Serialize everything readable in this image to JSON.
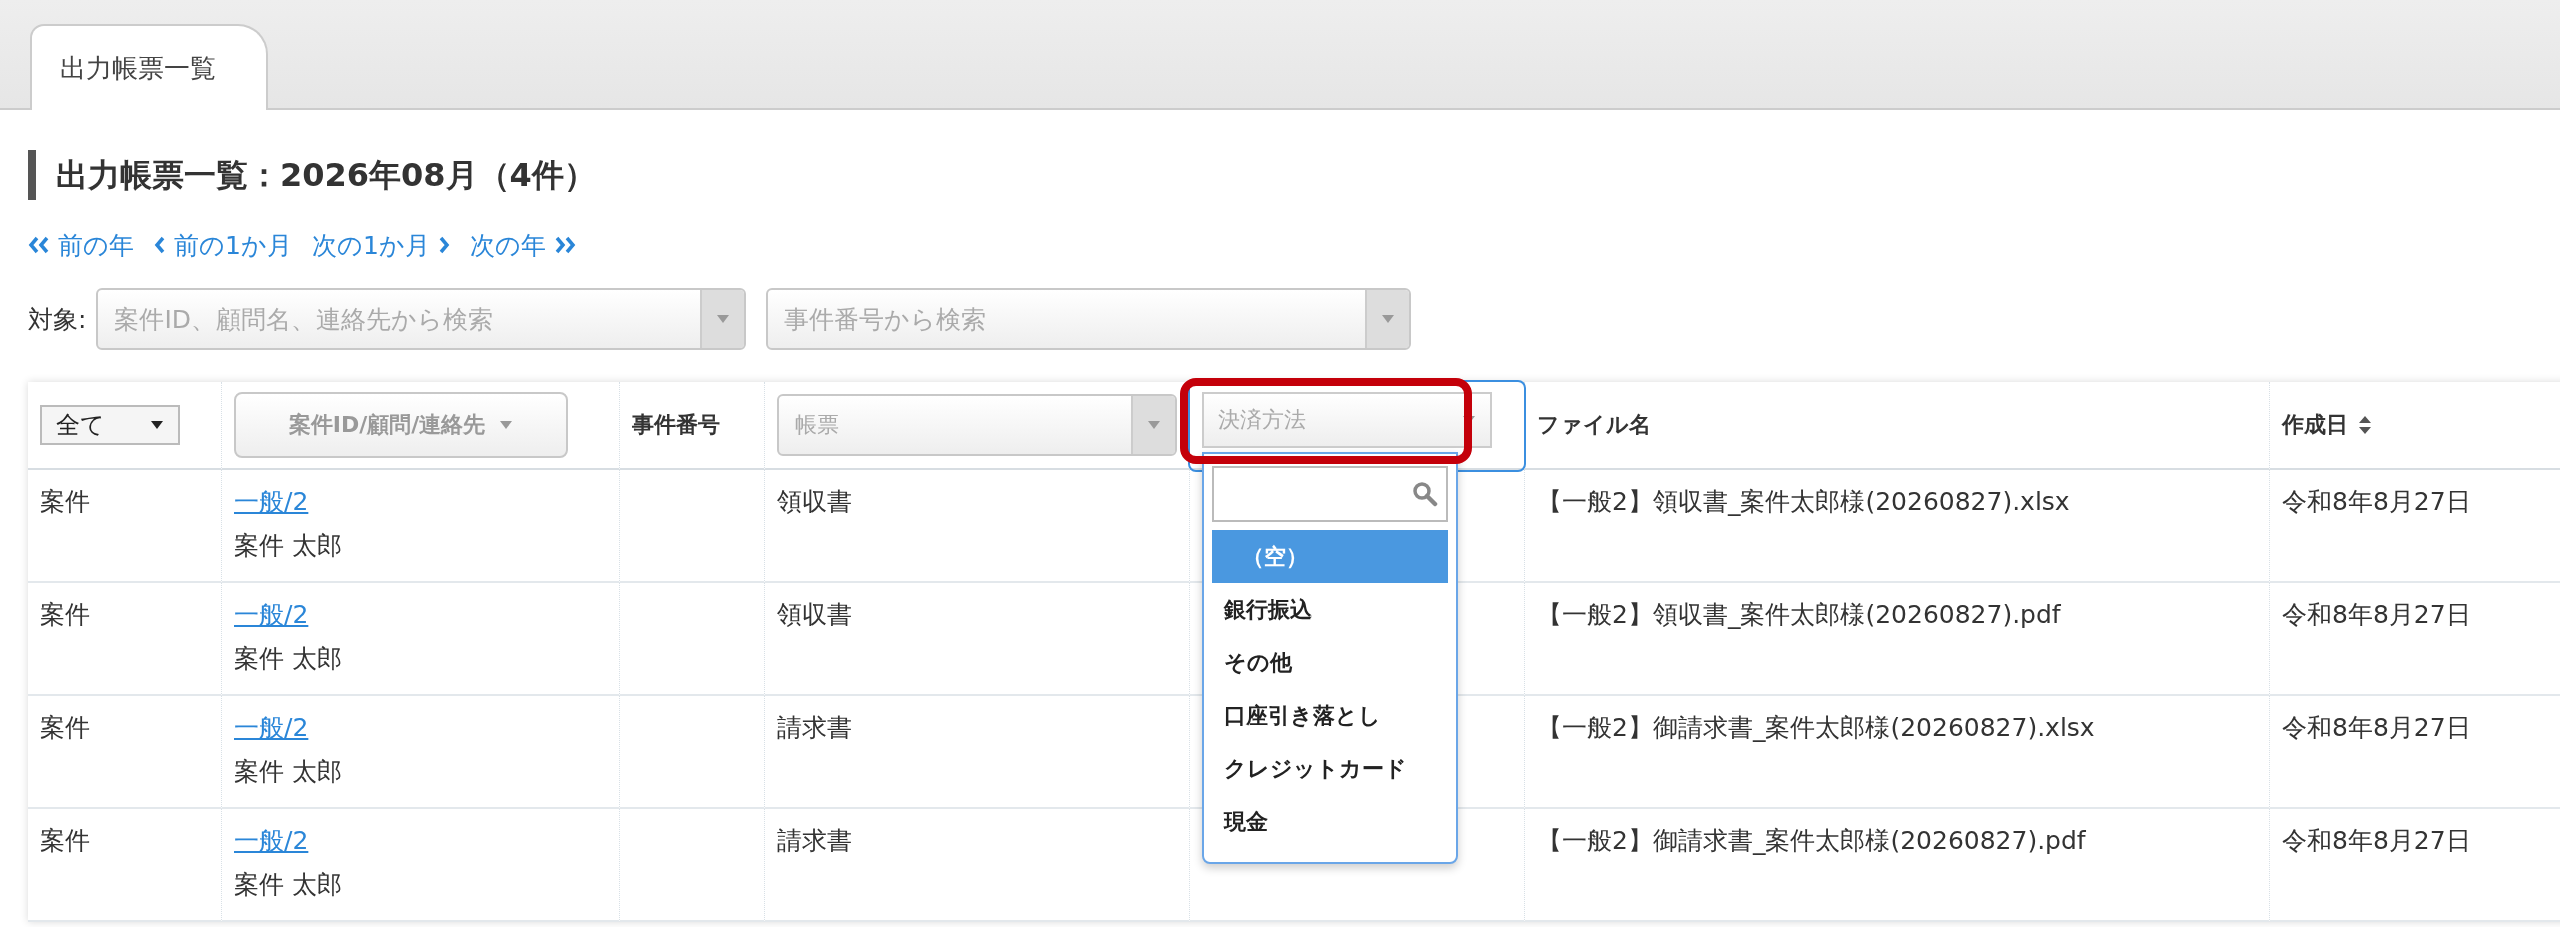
{
  "tabs": [
    {
      "label": "出力帳票一覧",
      "selected": true
    }
  ],
  "title": "出力帳票一覧：2026年08月（4件）",
  "nav": [
    {
      "kind": "back2",
      "label": "前の年"
    },
    {
      "kind": "back",
      "label": "前の1か月"
    },
    {
      "kind": "fwd",
      "label": "次の1か月"
    },
    {
      "kind": "fwd2",
      "label": "次の年"
    }
  ],
  "filters": {
    "label": "対象:",
    "selects": [
      {
        "placeholder": "案件ID、顧問名、連絡先から検索"
      },
      {
        "placeholder": "事件番号から検索"
      }
    ]
  },
  "table": {
    "type_filter": {
      "value": "全て"
    },
    "id_filter": {
      "placeholder": "案件ID/顧問/連絡先"
    },
    "case_heading": "事件番号",
    "doc_filter": {
      "placeholder": "帳票"
    },
    "payment_filter": {
      "placeholder": "決済方法",
      "expanded": true,
      "highlighted": true
    },
    "file_heading": "ファイル名",
    "date_heading": {
      "label": "作成日",
      "sortable": true
    },
    "rows": [
      {
        "type": "案件",
        "id_link": "一般/2",
        "name": "案件 太郎",
        "doc": "領収書",
        "file": "【一般2】領収書_案件太郎様(20260827).xlsx",
        "date": "令和8年8月27日"
      },
      {
        "type": "案件",
        "id_link": "一般/2",
        "name": "案件 太郎",
        "doc": "領収書",
        "file": "【一般2】領収書_案件太郎様(20260827).pdf",
        "date": "令和8年8月27日"
      },
      {
        "type": "案件",
        "id_link": "一般/2",
        "name": "案件 太郎",
        "doc": "請求書",
        "file": "【一般2】御請求書_案件太郎様(20260827).xlsx",
        "date": "令和8年8月27日"
      },
      {
        "type": "案件",
        "id_link": "一般/2",
        "name": "案件 太郎",
        "doc": "請求書",
        "file": "【一般2】御請求書_案件太郎様(20260827).pdf",
        "date": "令和8年8月27日"
      }
    ]
  },
  "dropdown": {
    "options": [
      {
        "label": "（空）",
        "selected": true
      },
      {
        "label": "銀行振込",
        "selected": false
      },
      {
        "label": "その他",
        "selected": false
      },
      {
        "label": "口座引き落とし",
        "selected": false
      },
      {
        "label": "クレジットカード",
        "selected": false
      },
      {
        "label": "現金",
        "selected": false
      }
    ]
  }
}
